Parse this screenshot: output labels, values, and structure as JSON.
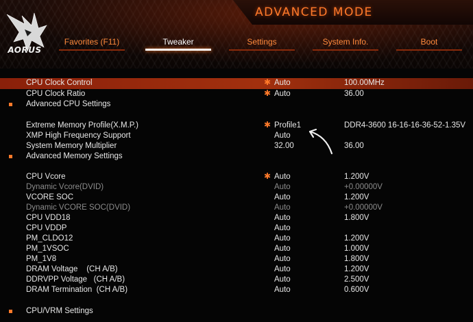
{
  "header": {
    "logo_text": "AORUS",
    "title": "ADVANCED MODE",
    "tabs": [
      {
        "label": "Favorites (F11)",
        "active": false
      },
      {
        "label": "Tweaker",
        "active": true
      },
      {
        "label": "Settings",
        "active": false
      },
      {
        "label": "System Info.",
        "active": false
      },
      {
        "label": "Boot",
        "active": false
      }
    ]
  },
  "rows": [
    {
      "label": "CPU Clock Control",
      "star": true,
      "value": "Auto",
      "current": "100.00MHz",
      "selected": true
    },
    {
      "label": "CPU Clock Ratio",
      "star": true,
      "value": "Auto",
      "current": "36.00"
    },
    {
      "label": "Advanced CPU Settings",
      "section": true
    },
    {
      "label": "Extreme Memory Profile(X.M.P.)",
      "star": true,
      "value": "Profile1",
      "current": "DDR4-3600 16-16-16-36-52-1.35V"
    },
    {
      "label": "XMP High Frequency Support",
      "value": "Auto"
    },
    {
      "label": "System Memory Multiplier",
      "value": "32.00",
      "current": "36.00"
    },
    {
      "label": "Advanced Memory Settings",
      "section": true
    },
    {
      "label": "CPU Vcore",
      "star": true,
      "value": "Auto",
      "current": "1.200V"
    },
    {
      "label": "Dynamic Vcore(DVID)",
      "value": "Auto",
      "current": "+0.00000V",
      "dim": true
    },
    {
      "label": "VCORE SOC",
      "value": "Auto",
      "current": "1.200V"
    },
    {
      "label": "Dynamic VCORE SOC(DVID)",
      "value": "Auto",
      "current": "+0.00000V",
      "dim": true
    },
    {
      "label": "CPU VDD18",
      "value": "Auto",
      "current": "1.800V"
    },
    {
      "label": "CPU VDDP",
      "value": "Auto"
    },
    {
      "label": "PM_CLDO12",
      "value": "Auto",
      "current": "1.200V"
    },
    {
      "label": "PM_1VSOC",
      "value": "Auto",
      "current": "1.000V"
    },
    {
      "label": "PM_1V8",
      "value": "Auto",
      "current": "1.800V"
    },
    {
      "label": "DRAM Voltage    (CH A/B)",
      "value": "Auto",
      "current": "1.200V"
    },
    {
      "label": "DDRVPP Voltage   (CH A/B)",
      "value": "Auto",
      "current": "2.500V"
    },
    {
      "label": "DRAM Termination  (CH A/B)",
      "value": "Auto",
      "current": "0.600V"
    },
    {
      "label": "CPU/VRM Settings",
      "section": true
    }
  ],
  "colors": {
    "accent": "#ff7a2a",
    "selected_row": "#a2300e",
    "dim_text": "#8c8c8c"
  }
}
